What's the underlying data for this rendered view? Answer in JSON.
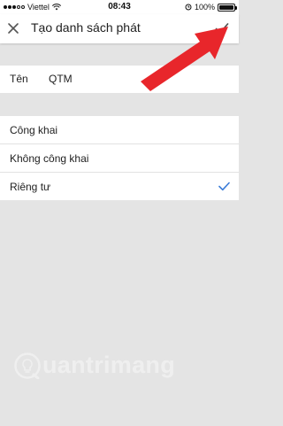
{
  "status_bar": {
    "carrier": "Viettel",
    "time": "08:43",
    "battery_percent": "100%",
    "battery_level": 1.0
  },
  "app_bar": {
    "title": "Tạo danh sách phát",
    "close_icon": "close-icon",
    "confirm_icon": "check-icon"
  },
  "name_field": {
    "label": "Tên",
    "value": "QTM"
  },
  "privacy": {
    "options": [
      {
        "label": "Công khai",
        "selected": false
      },
      {
        "label": "Không công khai",
        "selected": false
      },
      {
        "label": "Riêng tư",
        "selected": true
      }
    ],
    "check_color": "#3d7dd8"
  },
  "annotation": {
    "arrow_color": "#e8262b"
  },
  "watermark": {
    "text": "uantrimang"
  },
  "colors": {
    "background": "#e4e4e4",
    "surface": "#ffffff"
  }
}
